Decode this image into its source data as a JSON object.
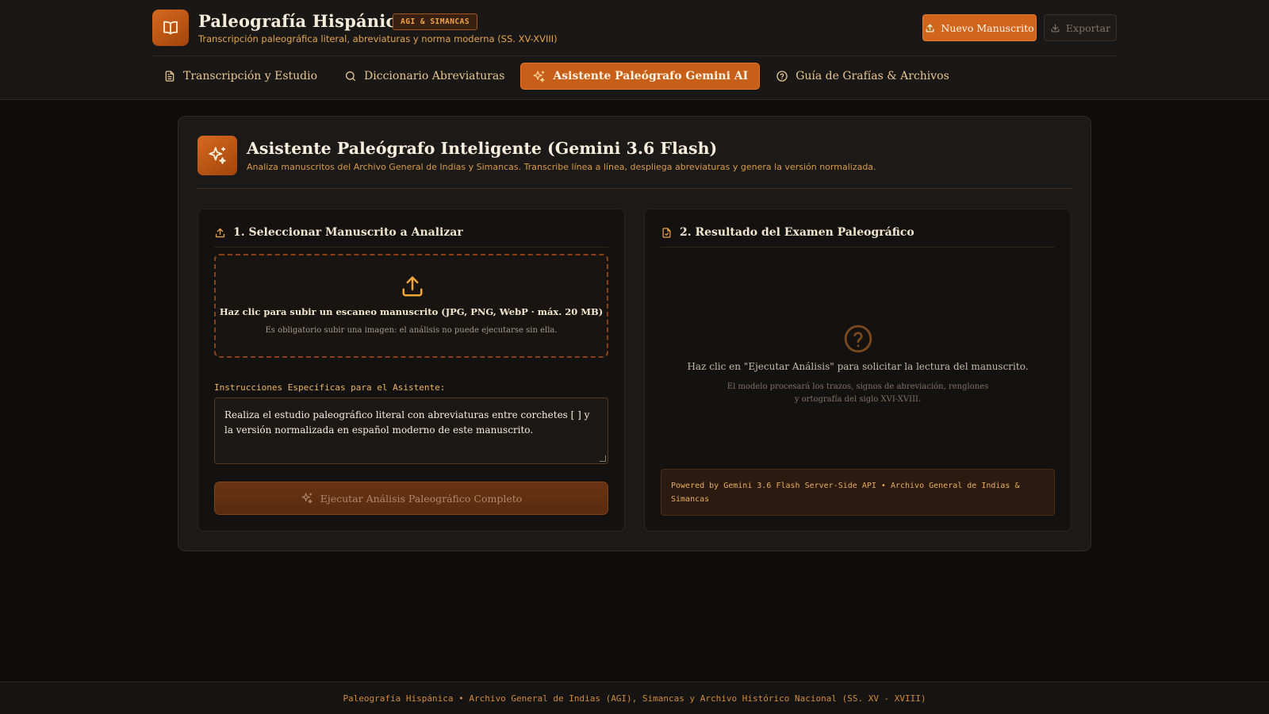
{
  "header": {
    "title": "Paleografía Hispánica",
    "badge": "AGI & SIMANCAS",
    "subtitle": "Transcripción paleográfica literal, abreviaturas y norma moderna (SS. XV-XVIII)",
    "new_button": "Nuevo Manuscrito",
    "export_button": "Exportar"
  },
  "tabs": [
    {
      "label": "Transcripción y Estudio",
      "icon": "document-icon"
    },
    {
      "label": "Diccionario Abreviaturas",
      "icon": "search-icon"
    },
    {
      "label": "Asistente Paleógrafo Gemini AI",
      "icon": "sparkles-icon",
      "active": true
    },
    {
      "label": "Guía de Grafías & Archivos",
      "icon": "help-circle-icon"
    }
  ],
  "card": {
    "title": "Asistente Paleógrafo Inteligente (Gemini 3.6 Flash)",
    "subtitle": "Analiza manuscritos del Archivo General de Indias y Simancas. Transcribe línea a línea, despliega abreviaturas y genera la versión normalizada."
  },
  "upload_panel": {
    "heading": "1. Seleccionar Manuscrito a Analizar",
    "dropzone_main": "Haz clic para subir un escaneo manuscrito (JPG, PNG, WebP · máx. 20 MB)",
    "dropzone_note": "Es obligatorio subir una imagen: el análisis no puede ejecutarse sin ella.",
    "instructions_label": "Instrucciones Específicas para el Asistente:",
    "instructions_value": "Realiza el estudio paleográfico literal con abreviaturas entre corchetes [ ] y la versión normalizada en español moderno de este manuscrito.",
    "run_button": "Ejecutar Análisis Paleográfico Completo"
  },
  "result_panel": {
    "heading": "2. Resultado del Examen Paleográfico",
    "empty_main": "Haz clic en \"Ejecutar Análisis\" para solicitar la lectura del manuscrito.",
    "empty_note": "El modelo procesará los trazos, signos de abreviación, renglones y ortografía del siglo XVI-XVIII.",
    "powered_by": "Powered by Gemini 3.6 Flash Server-Side API • Archivo General de Indias & Simancas"
  },
  "footer": {
    "text": "Paleografía Hispánica • Archivo General de Indias (AGI), Simancas y Archivo Histórico Nacional (SS. XV - XVIII)"
  },
  "colors": {
    "background": "#0f0d0b",
    "accent": "#d2651c",
    "gold": "#e8b25c"
  }
}
